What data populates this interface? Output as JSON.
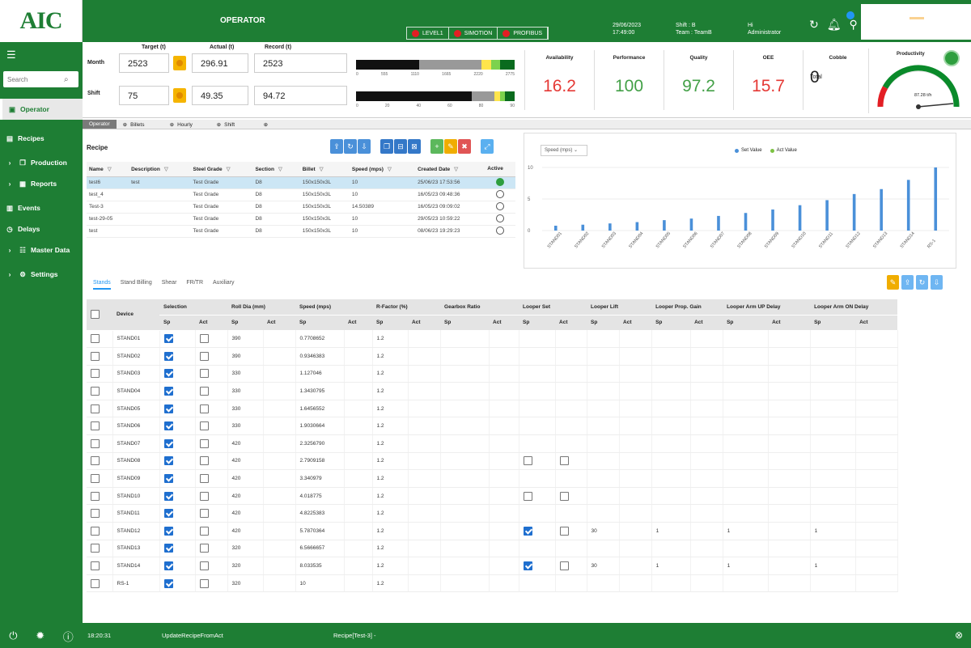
{
  "sidebar": {
    "logo_text": "AIC",
    "search_placeholder": "Search",
    "items": [
      {
        "label": "Operator",
        "icon": "square-icon",
        "active": true
      },
      {
        "label": "Recipes",
        "icon": "document-icon",
        "active": false
      },
      {
        "label": "Production",
        "icon": "folder-icon",
        "active": false
      },
      {
        "label": "Reports",
        "icon": "grid-icon",
        "active": false
      },
      {
        "label": "Events",
        "icon": "calendar-icon",
        "active": false
      },
      {
        "label": "Delays",
        "icon": "clock-icon",
        "active": false
      },
      {
        "label": "Master Data",
        "icon": "database-icon",
        "active": false
      },
      {
        "label": "Settings",
        "icon": "gear-icon",
        "active": false
      }
    ]
  },
  "header": {
    "title": "OPERATOR",
    "statuses": [
      "LEVEL1",
      "SIMOTION",
      "PROFIBUS"
    ],
    "datetime": [
      "29/06/2023",
      "17:49:00"
    ],
    "shift": [
      "Shift : B",
      "Team : TeamB"
    ],
    "user": [
      "Hi",
      "Administrator"
    ]
  },
  "metrics": {
    "col_target": "Target (t)",
    "col_actual": "Actual (t)",
    "col_record": "Record (t)",
    "month_label": "Month",
    "shift_label": "Shift",
    "month_target": "2523",
    "month_actual": "296.91",
    "month_record": "2523",
    "month_record_date": "",
    "shift_target": "75",
    "shift_actual": "49.35",
    "shift_record": "94.72",
    "shift_record_date": "",
    "month_scale": [
      "0",
      "555",
      "1110",
      "1665",
      "2220",
      "2775"
    ],
    "shift_scale": [
      "0",
      "20",
      "40",
      "60",
      "80",
      "90"
    ]
  },
  "kpis": [
    {
      "label": "Availability",
      "value": "16.2",
      "color": "red"
    },
    {
      "label": "Performance",
      "value": "100",
      "color": "green"
    },
    {
      "label": "Quality",
      "value": "97.2",
      "color": "green"
    },
    {
      "label": "OEE",
      "value": "15.7",
      "color": "red"
    },
    {
      "label": "Cobble",
      "sub": "Total",
      "value": "0",
      "color": "blk"
    }
  ],
  "gauge": {
    "label": "Productivity",
    "value_text": "87.28 t/h"
  },
  "view_tabs": [
    "Operator",
    "Billets",
    "Hourly",
    "Shift",
    ""
  ],
  "recipe": {
    "title": "Recipe",
    "columns": [
      "Name",
      "Description",
      "Steel Grade",
      "Section",
      "Billet",
      "Speed (mps)",
      "Created Date",
      "Active"
    ],
    "rows": [
      {
        "name": "test6",
        "desc": "test",
        "grade": "Test Grade",
        "section": "D8",
        "billet": "150x150x3L",
        "speed": "10",
        "date": "25/06/23 17:53:56",
        "active": true
      },
      {
        "name": "test_4",
        "desc": "",
        "grade": "Test Grade",
        "section": "D8",
        "billet": "150x150x3L",
        "speed": "10",
        "date": "16/05/23 09:48:36",
        "active": false
      },
      {
        "name": "Test-3",
        "desc": "",
        "grade": "Test Grade",
        "section": "D8",
        "billet": "150x150x3L",
        "speed": "14.50389",
        "date": "16/05/23 09:09:02",
        "active": false
      },
      {
        "name": "test-29-05",
        "desc": "",
        "grade": "Test Grade",
        "section": "D8",
        "billet": "150x150x3L",
        "speed": "10",
        "date": "29/05/23 10:59:22",
        "active": false
      },
      {
        "name": "test",
        "desc": "",
        "grade": "Test Grade",
        "section": "D8",
        "billet": "150x150x3L",
        "speed": "10",
        "date": "08/06/23 19:29:23",
        "active": false
      }
    ]
  },
  "chart_select": "Speed (mps)",
  "chart_data": {
    "type": "bar",
    "legend": [
      "Set Value",
      "Act Value"
    ],
    "colors": {
      "set": "#4a90d9",
      "act": "#7cc242"
    },
    "categories": [
      "STAND01",
      "STAND02",
      "STAND03",
      "STAND04",
      "STAND05",
      "STAND06",
      "STAND07",
      "STAND08",
      "STAND09",
      "STAND10",
      "STAND11",
      "STAND12",
      "STAND13",
      "STAND14",
      "RS-1"
    ],
    "series": [
      {
        "name": "Set Value",
        "values": [
          0.77,
          0.93,
          1.13,
          1.34,
          1.65,
          1.9,
          2.32,
          2.79,
          3.34,
          4.02,
          4.82,
          5.79,
          6.57,
          8.03,
          10
        ]
      }
    ],
    "ylim": [
      0,
      10
    ],
    "yticks": [
      "10",
      "5",
      "0"
    ]
  },
  "stand_tabs": [
    "Stands",
    "Stand Billing",
    "Shear",
    "FR/TR",
    "Auxiliary"
  ],
  "stands": {
    "group_headers": [
      "Device",
      "Selection",
      "Roll Dia (mm)",
      "Speed (mps)",
      "R-Factor (%)",
      "Gearbox Ratio",
      "Looper Set",
      "Looper Lift",
      "Looper Prop. Gain",
      "Looper Arm UP Delay",
      "Looper Arm ON Delay"
    ],
    "sp": "Sp",
    "act": "Act",
    "rows": [
      {
        "device": "STAND01",
        "sel": true,
        "dia": "390",
        "speed": "0.7708652",
        "rf": "1.2",
        "ls": null,
        "lift": "",
        "gain": "",
        "up": "",
        "on": ""
      },
      {
        "device": "STAND02",
        "sel": true,
        "dia": "390",
        "speed": "0.9346383",
        "rf": "1.2",
        "ls": null,
        "lift": "",
        "gain": "",
        "up": "",
        "on": ""
      },
      {
        "device": "STAND03",
        "sel": true,
        "dia": "330",
        "speed": "1.127046",
        "rf": "1.2",
        "ls": null,
        "lift": "",
        "gain": "",
        "up": "",
        "on": ""
      },
      {
        "device": "STAND04",
        "sel": true,
        "dia": "330",
        "speed": "1.3430795",
        "rf": "1.2",
        "ls": null,
        "lift": "",
        "gain": "",
        "up": "",
        "on": ""
      },
      {
        "device": "STAND05",
        "sel": true,
        "dia": "330",
        "speed": "1.6456552",
        "rf": "1.2",
        "ls": null,
        "lift": "",
        "gain": "",
        "up": "",
        "on": ""
      },
      {
        "device": "STAND06",
        "sel": true,
        "dia": "330",
        "speed": "1.9030664",
        "rf": "1.2",
        "ls": null,
        "lift": "",
        "gain": "",
        "up": "",
        "on": ""
      },
      {
        "device": "STAND07",
        "sel": true,
        "dia": "420",
        "speed": "2.3256790",
        "rf": "1.2",
        "ls": null,
        "lift": "",
        "gain": "",
        "up": "",
        "on": ""
      },
      {
        "device": "STAND08",
        "sel": true,
        "dia": "420",
        "speed": "2.7909158",
        "rf": "1.2",
        "ls": [
          false,
          false
        ],
        "lift": "",
        "gain": "",
        "up": "",
        "on": ""
      },
      {
        "device": "STAND09",
        "sel": true,
        "dia": "420",
        "speed": "3.340979",
        "rf": "1.2",
        "ls": null,
        "lift": "",
        "gain": "",
        "up": "",
        "on": ""
      },
      {
        "device": "STAND10",
        "sel": true,
        "dia": "420",
        "speed": "4.018775",
        "rf": "1.2",
        "ls": [
          false,
          false
        ],
        "lift": "",
        "gain": "",
        "up": "",
        "on": ""
      },
      {
        "device": "STAND11",
        "sel": true,
        "dia": "420",
        "speed": "4.8225383",
        "rf": "1.2",
        "ls": null,
        "lift": "",
        "gain": "",
        "up": "",
        "on": ""
      },
      {
        "device": "STAND12",
        "sel": true,
        "dia": "420",
        "speed": "5.7870364",
        "rf": "1.2",
        "ls": [
          true,
          false
        ],
        "lift": "30",
        "gain": "1",
        "up": "1",
        "on": "1"
      },
      {
        "device": "STAND13",
        "sel": true,
        "dia": "320",
        "speed": "6.5666657",
        "rf": "1.2",
        "ls": null,
        "lift": "",
        "gain": "",
        "up": "",
        "on": ""
      },
      {
        "device": "STAND14",
        "sel": true,
        "dia": "320",
        "speed": "8.033535",
        "rf": "1.2",
        "ls": [
          true,
          false
        ],
        "lift": "30",
        "gain": "1",
        "up": "1",
        "on": "1"
      },
      {
        "device": "RS-1",
        "sel": true,
        "dia": "320",
        "speed": "10",
        "rf": "1.2",
        "ls": null,
        "lift": "",
        "gain": "",
        "up": "",
        "on": ""
      }
    ]
  },
  "statusbar": {
    "time": "18:20:31",
    "message1": "UpdateRecipeFromAct",
    "message2": "Recipe[Test-3] -"
  }
}
